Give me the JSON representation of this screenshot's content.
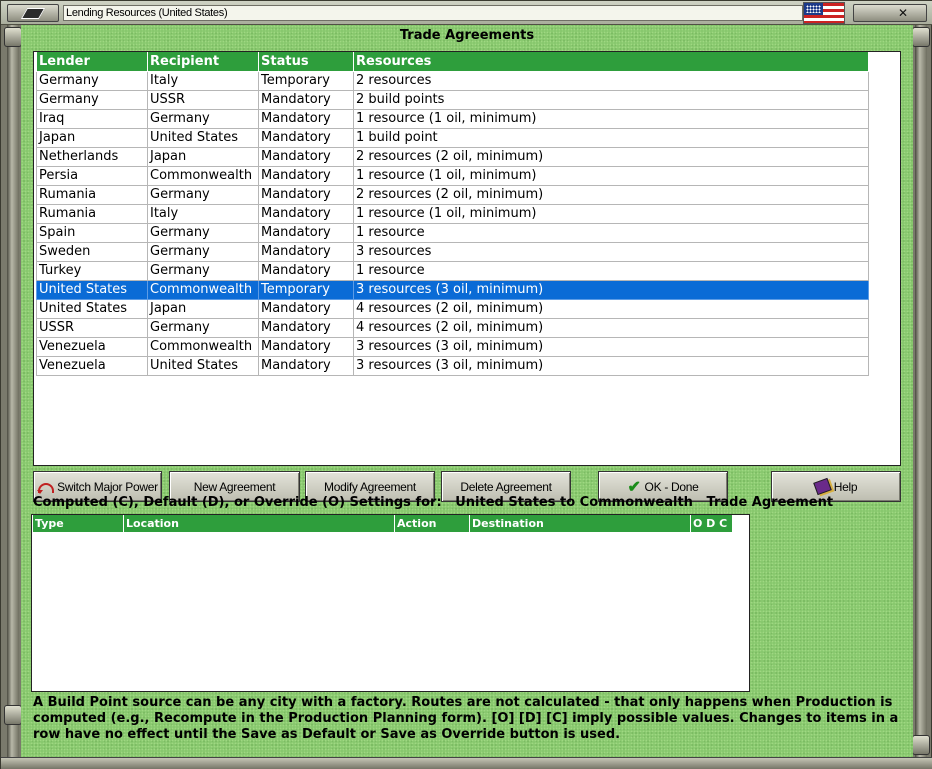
{
  "window": {
    "title": "Lending Resources (United States)",
    "flag_icon": "us-flag-icon"
  },
  "heading": "Trade Agreements",
  "trade_table": {
    "columns": [
      "Lender",
      "Recipient",
      "Status",
      "Resources"
    ],
    "rows": [
      [
        "Germany",
        "Italy",
        "Temporary",
        "2 resources"
      ],
      [
        "Germany",
        "USSR",
        "Mandatory",
        "2 build points"
      ],
      [
        "Iraq",
        "Germany",
        "Mandatory",
        "1 resource (1 oil, minimum)"
      ],
      [
        "Japan",
        "United States",
        "Mandatory",
        "1 build point"
      ],
      [
        "Netherlands",
        "Japan",
        "Mandatory",
        "2 resources (2 oil, minimum)"
      ],
      [
        "Persia",
        "Commonwealth",
        "Mandatory",
        "1 resource (1 oil, minimum)"
      ],
      [
        "Rumania",
        "Germany",
        "Mandatory",
        "2 resources (2 oil, minimum)"
      ],
      [
        "Rumania",
        "Italy",
        "Mandatory",
        "1 resource (1 oil, minimum)"
      ],
      [
        "Spain",
        "Germany",
        "Mandatory",
        "1 resource"
      ],
      [
        "Sweden",
        "Germany",
        "Mandatory",
        "3 resources"
      ],
      [
        "Turkey",
        "Germany",
        "Mandatory",
        "1 resource"
      ],
      [
        "United States",
        "Commonwealth",
        "Temporary",
        "3 resources (3 oil, minimum)"
      ],
      [
        "United States",
        "Japan",
        "Mandatory",
        "4 resources (2 oil, minimum)"
      ],
      [
        "USSR",
        "Germany",
        "Mandatory",
        "4 resources (2 oil, minimum)"
      ],
      [
        "Venezuela",
        "Commonwealth",
        "Mandatory",
        "3 resources (3 oil, minimum)"
      ],
      [
        "Venezuela",
        "United States",
        "Mandatory",
        "3 resources (3 oil, minimum)"
      ]
    ],
    "selected_row": 11
  },
  "buttons": {
    "switch_major_power": "Switch Major Power",
    "new_agreement": "New Agreement",
    "modify_agreement": "Modify Agreement",
    "delete_agreement": "Delete Agreement",
    "ok_done": "OK - Done",
    "help": "Help"
  },
  "settings": {
    "label": "Computed (C), Default (D), or Override (O) Settings for:",
    "subject": "United States to Commonwealth",
    "suffix": "Trade Agreement",
    "columns": [
      "Type",
      "Location",
      "Action",
      "Destination",
      "O D C"
    ]
  },
  "footer_text": "A Build Point source can be any city with a factory. Routes are not calculated - that only happens when Production is computed (e.g., Recompute in the Production Planning form).  [O] [D] [C] imply possible values.  Changes to items in a row have no effect until the Save as Default or Save as Override button is used."
}
